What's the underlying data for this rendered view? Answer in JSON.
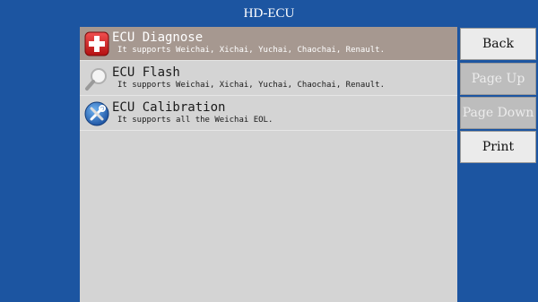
{
  "window": {
    "title": "HD-ECU"
  },
  "menu": {
    "items": [
      {
        "title": "ECU Diagnose",
        "description": "It supports Weichai, Xichai, Yuchai, Chaochai, Renault.",
        "icon": "red-cross-icon",
        "selected": true
      },
      {
        "title": "ECU Flash",
        "description": "It supports Weichai, Xichai, Yuchai, Chaochai, Renault.",
        "icon": "magnifier-icon",
        "selected": false
      },
      {
        "title": "ECU Calibration",
        "description": "It supports all the Weichai EOL.",
        "icon": "tools-icon",
        "selected": false
      }
    ]
  },
  "sidebar": {
    "back_label": "Back",
    "page_up_label": "Page Up",
    "page_down_label": "Page Down",
    "print_label": "Print"
  },
  "colors": {
    "background": "#1c55a1",
    "panel": "#d4d4d4",
    "selected_row": "#a69890",
    "button_enabled": "#ebebeb",
    "button_disabled": "#bdbdbd"
  }
}
